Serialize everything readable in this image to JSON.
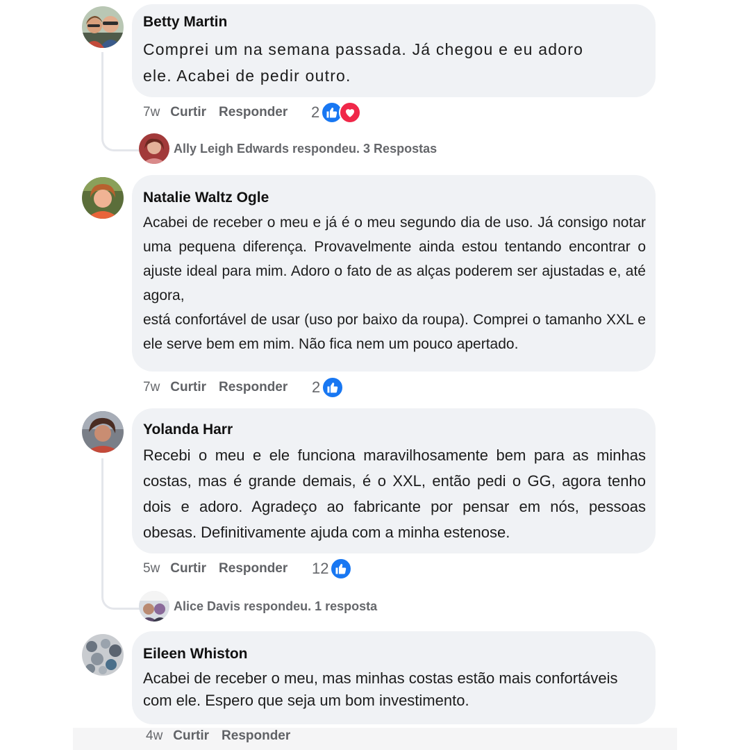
{
  "comments": [
    {
      "author": "Betty Martin",
      "text": "Comprei um na semana passada. Já chegou e eu adoro\nele. Acabei de pedir outro.",
      "time": "7w",
      "like_label": "Curtir",
      "reply_label": "Responder",
      "reaction_count": "2",
      "reactions": [
        "like-icon",
        "love-icon"
      ],
      "replies": "Ally Leigh Edwards respondeu. 3 Respostas"
    },
    {
      "author": "Natalie Waltz Ogle",
      "text": "Acabei de receber o meu e já é o meu segundo dia de uso. Já consigo notar uma pequena diferença. Provavelmente ainda estou tentando encontrar o ajuste ideal para mim. Adoro o fato de as alças poderem ser ajustadas e, até agora,\nestá confortável de usar (uso por baixo da roupa). Comprei o tamanho XXL e ele serve bem em mim. Não fica nem um pouco apertado.",
      "time": "7w",
      "like_label": "Curtir",
      "reply_label": "Responder",
      "reaction_count": "2",
      "reactions": [
        "like-icon"
      ]
    },
    {
      "author": "Yolanda Harr",
      "text": "Recebi o meu e ele funciona maravilhosamente bem para as minhas costas, mas é grande demais, é o XXL, então pedi o GG, agora tenho dois e adoro. Agradeço ao fabricante por pensar em nós, pessoas obesas. Definitivamente ajuda com a minha estenose.",
      "time": "5w",
      "like_label": "Curtir",
      "reply_label": "Responder",
      "reaction_count": "12",
      "reactions": [
        "like-icon"
      ],
      "replies": "Alice Davis respondeu. 1 resposta"
    },
    {
      "author": "Eileen Whiston",
      "text": "Acabei de receber o meu, mas minhas costas estão mais confortáveis com ele. Espero que seja um bom investimento.",
      "time": "4w",
      "like_label": "Curtir",
      "reply_label": "Responder"
    }
  ],
  "colors": {
    "bubble": "#f0f2f5",
    "like": "#1877f2",
    "love": "#f02849",
    "meta": "#65676b"
  }
}
